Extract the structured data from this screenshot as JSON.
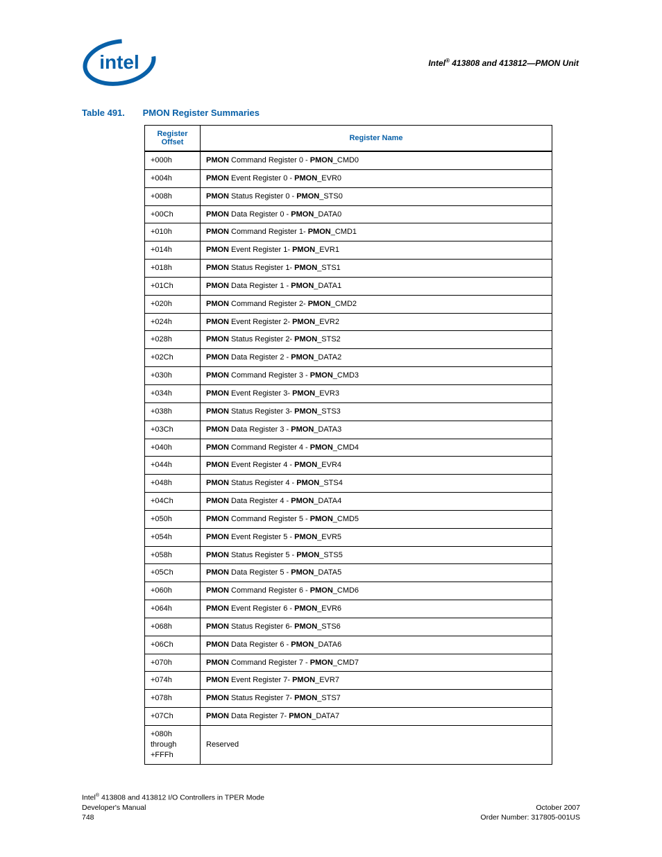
{
  "header": {
    "title_prefix": "Intel",
    "title_rest": " 413808 and 413812—PMON Unit"
  },
  "caption": {
    "number": "Table 491.",
    "title": "PMON Register Summaries"
  },
  "columns": {
    "offset": "Register\nOffset",
    "name": "Register Name"
  },
  "rows": [
    {
      "offset": "+000h",
      "b1": "PMON",
      "t1": " Command Register 0 - ",
      "b2": "PMON",
      "t2": "_CMD0"
    },
    {
      "offset": "+004h",
      "b1": "PMON",
      "t1": " Event Register 0 - ",
      "b2": "PMON",
      "t2": "_EVR0"
    },
    {
      "offset": "+008h",
      "b1": "PMON",
      "t1": " Status Register 0 - ",
      "b2": "PMON",
      "t2": "_STS0"
    },
    {
      "offset": "+00Ch",
      "b1": "PMON",
      "t1": " Data Register 0 - ",
      "b2": "PMON",
      "t2": "_DATA0"
    },
    {
      "offset": "+010h",
      "b1": "PMON",
      "t1": " Command Register 1- ",
      "b2": "PMON",
      "t2": "_CMD1"
    },
    {
      "offset": "+014h",
      "b1": "PMON",
      "t1": " Event Register 1- ",
      "b2": "PMON",
      "t2": "_EVR1"
    },
    {
      "offset": "+018h",
      "b1": "PMON",
      "t1": " Status Register 1- ",
      "b2": "PMON",
      "t2": "_STS1"
    },
    {
      "offset": "+01Ch",
      "b1": "PMON",
      "t1": " Data Register 1 - ",
      "b2": "PMON",
      "t2": "_DATA1"
    },
    {
      "offset": "+020h",
      "b1": "PMON",
      "t1": " Command Register 2- ",
      "b2": "PMON",
      "t2": "_CMD2"
    },
    {
      "offset": "+024h",
      "b1": "PMON",
      "t1": " Event Register 2- ",
      "b2": "PMON",
      "t2": "_EVR2"
    },
    {
      "offset": "+028h",
      "b1": "PMON",
      "t1": " Status Register 2- ",
      "b2": "PMON",
      "t2": "_STS2"
    },
    {
      "offset": "+02Ch",
      "b1": "PMON",
      "t1": " Data Register 2 - ",
      "b2": "PMON",
      "t2": "_DATA2"
    },
    {
      "offset": "+030h",
      "b1": "PMON",
      "t1": " Command Register 3 - ",
      "b2": "PMON",
      "t2": "_CMD3"
    },
    {
      "offset": "+034h",
      "b1": "PMON",
      "t1": " Event Register 3- ",
      "b2": "PMON",
      "t2": "_EVR3"
    },
    {
      "offset": "+038h",
      "b1": "PMON",
      "t1": " Status Register 3- ",
      "b2": "PMON",
      "t2": "_STS3"
    },
    {
      "offset": "+03Ch",
      "b1": "PMON",
      "t1": " Data Register 3 - ",
      "b2": "PMON",
      "t2": "_DATA3"
    },
    {
      "offset": "+040h",
      "b1": "PMON",
      "t1": " Command Register 4 - ",
      "b2": "PMON",
      "t2": "_CMD4"
    },
    {
      "offset": "+044h",
      "b1": "PMON",
      "t1": " Event Register 4 - ",
      "b2": "PMON",
      "t2": "_EVR4"
    },
    {
      "offset": "+048h",
      "b1": "PMON",
      "t1": " Status Register 4 - ",
      "b2": "PMON",
      "t2": "_STS4"
    },
    {
      "offset": "+04Ch",
      "b1": "PMON",
      "t1": " Data Register 4 - ",
      "b2": "PMON",
      "t2": "_DATA4"
    },
    {
      "offset": "+050h",
      "b1": "PMON",
      "t1": " Command Register 5 - ",
      "b2": "PMON",
      "t2": "_CMD5"
    },
    {
      "offset": "+054h",
      "b1": "PMON",
      "t1": " Event Register 5 - ",
      "b2": "PMON",
      "t2": "_EVR5"
    },
    {
      "offset": "+058h",
      "b1": "PMON",
      "t1": " Status Register 5 - ",
      "b2": "PMON",
      "t2": "_STS5"
    },
    {
      "offset": "+05Ch",
      "b1": "PMON",
      "t1": " Data Register 5 - ",
      "b2": "PMON",
      "t2": "_DATA5"
    },
    {
      "offset": "+060h",
      "b1": "PMON",
      "t1": " Command Register 6 - ",
      "b2": "PMON",
      "t2": "_CMD6"
    },
    {
      "offset": "+064h",
      "b1": "PMON",
      "t1": " Event Register 6 - ",
      "b2": "PMON",
      "t2": "_EVR6"
    },
    {
      "offset": "+068h",
      "b1": "PMON",
      "t1": " Status Register 6- ",
      "b2": "PMON",
      "t2": "_STS6"
    },
    {
      "offset": "+06Ch",
      "b1": "PMON",
      "t1": " Data Register 6 - ",
      "b2": "PMON",
      "t2": "_DATA6"
    },
    {
      "offset": "+070h",
      "b1": "PMON",
      "t1": " Command Register 7 - ",
      "b2": "PMON",
      "t2": "_CMD7"
    },
    {
      "offset": "+074h",
      "b1": "PMON",
      "t1": " Event Register 7- ",
      "b2": "PMON",
      "t2": "_EVR7"
    },
    {
      "offset": "+078h",
      "b1": "PMON",
      "t1": " Status Register 7- ",
      "b2": "PMON",
      "t2": "_STS7"
    },
    {
      "offset": "+07Ch",
      "b1": "PMON",
      "t1": " Data Register 7- ",
      "b2": "PMON",
      "t2": "_DATA7"
    },
    {
      "offset": "+080h\nthrough\n+FFFh",
      "plain": "Reserved"
    }
  ],
  "footer": {
    "left1_prefix": "Intel",
    "left1_rest": " 413808 and 413812 I/O Controllers in TPER Mode",
    "left2": "Developer's Manual",
    "left3": "748",
    "right1": "October 2007",
    "right2": "Order Number: 317805-001US"
  }
}
